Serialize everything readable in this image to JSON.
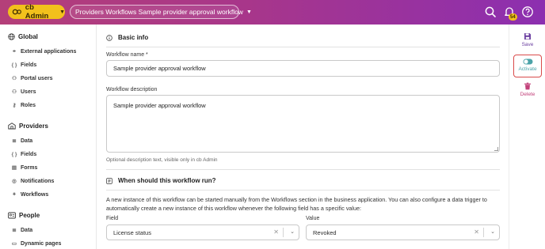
{
  "header": {
    "app_label": "cb Admin",
    "breadcrumb": "Providers Workflows Sample provider approval workflow",
    "notification_count": "54"
  },
  "sidebar": {
    "global": {
      "title": "Global",
      "items": [
        "External applications",
        "Fields",
        "Portal users",
        "Users",
        "Roles"
      ]
    },
    "providers": {
      "title": "Providers",
      "items": [
        "Data",
        "Fields",
        "Forms",
        "Notifications",
        "Workflows"
      ]
    },
    "people": {
      "title": "People",
      "items": [
        "Data",
        "Dynamic pages"
      ]
    }
  },
  "main": {
    "basic_info": {
      "title": "Basic info",
      "name_label": "Workflow name *",
      "name_value": "Sample provider approval workflow",
      "desc_label": "Workflow description",
      "desc_value": "Sample provider approval workflow",
      "desc_help": "Optional description text, visible only in cb Admin"
    },
    "trigger": {
      "title": "When should this workflow run?",
      "description": "A new instance of this workflow can be started manually from the Workflows section in the business application. You can also configure a data trigger to automatically create a new instance of this workflow whenever the following field has a specific value:",
      "field_label": "Field",
      "field_value": "License status",
      "value_label": "Value",
      "value_value": "Revoked"
    }
  },
  "actions": {
    "save": "Save",
    "activate": "Activate",
    "delete": "Delete"
  },
  "colors": {
    "header_gradient_start": "#b43f79",
    "header_gradient_end": "#8c2fb0",
    "app_pill": "#f2c11c",
    "save_icon": "#6b3fa0",
    "activate_icon": "#4ba3a8",
    "delete": "#c2417a",
    "highlight_border": "#d94a4a"
  }
}
